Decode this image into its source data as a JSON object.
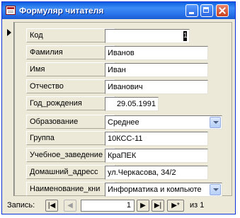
{
  "window": {
    "title": "Формуляр читателя"
  },
  "fields": {
    "kod": {
      "label": "Код",
      "value": "1"
    },
    "familiya": {
      "label": "Фамилия",
      "value": "Иванов"
    },
    "imya": {
      "label": "Имя",
      "value": "Иван"
    },
    "otchestvo": {
      "label": "Отчество",
      "value": "Иванович"
    },
    "god": {
      "label": "Год_рождения",
      "value": "29.05.1991"
    },
    "obrazovanie": {
      "label": "Образование",
      "value": "Среднее"
    },
    "gruppa": {
      "label": "Группа",
      "value": "10КСС-11"
    },
    "uchebnoe": {
      "label": "Учебное_заведение",
      "value": "КраПЕК"
    },
    "adres": {
      "label": "Домашний_адресс",
      "value": "ул.Черкасова, 34/2"
    },
    "naimenovanie": {
      "label": "Наименование_кни",
      "value": "Информатика и компьюте"
    }
  },
  "navigation": {
    "label": "Запись:",
    "current": "1",
    "of_text": "из 1",
    "first_icon": "|◀",
    "prev_icon": "◀",
    "next_icon": "▶",
    "last_icon": "▶|",
    "new_icon": "▶*"
  }
}
